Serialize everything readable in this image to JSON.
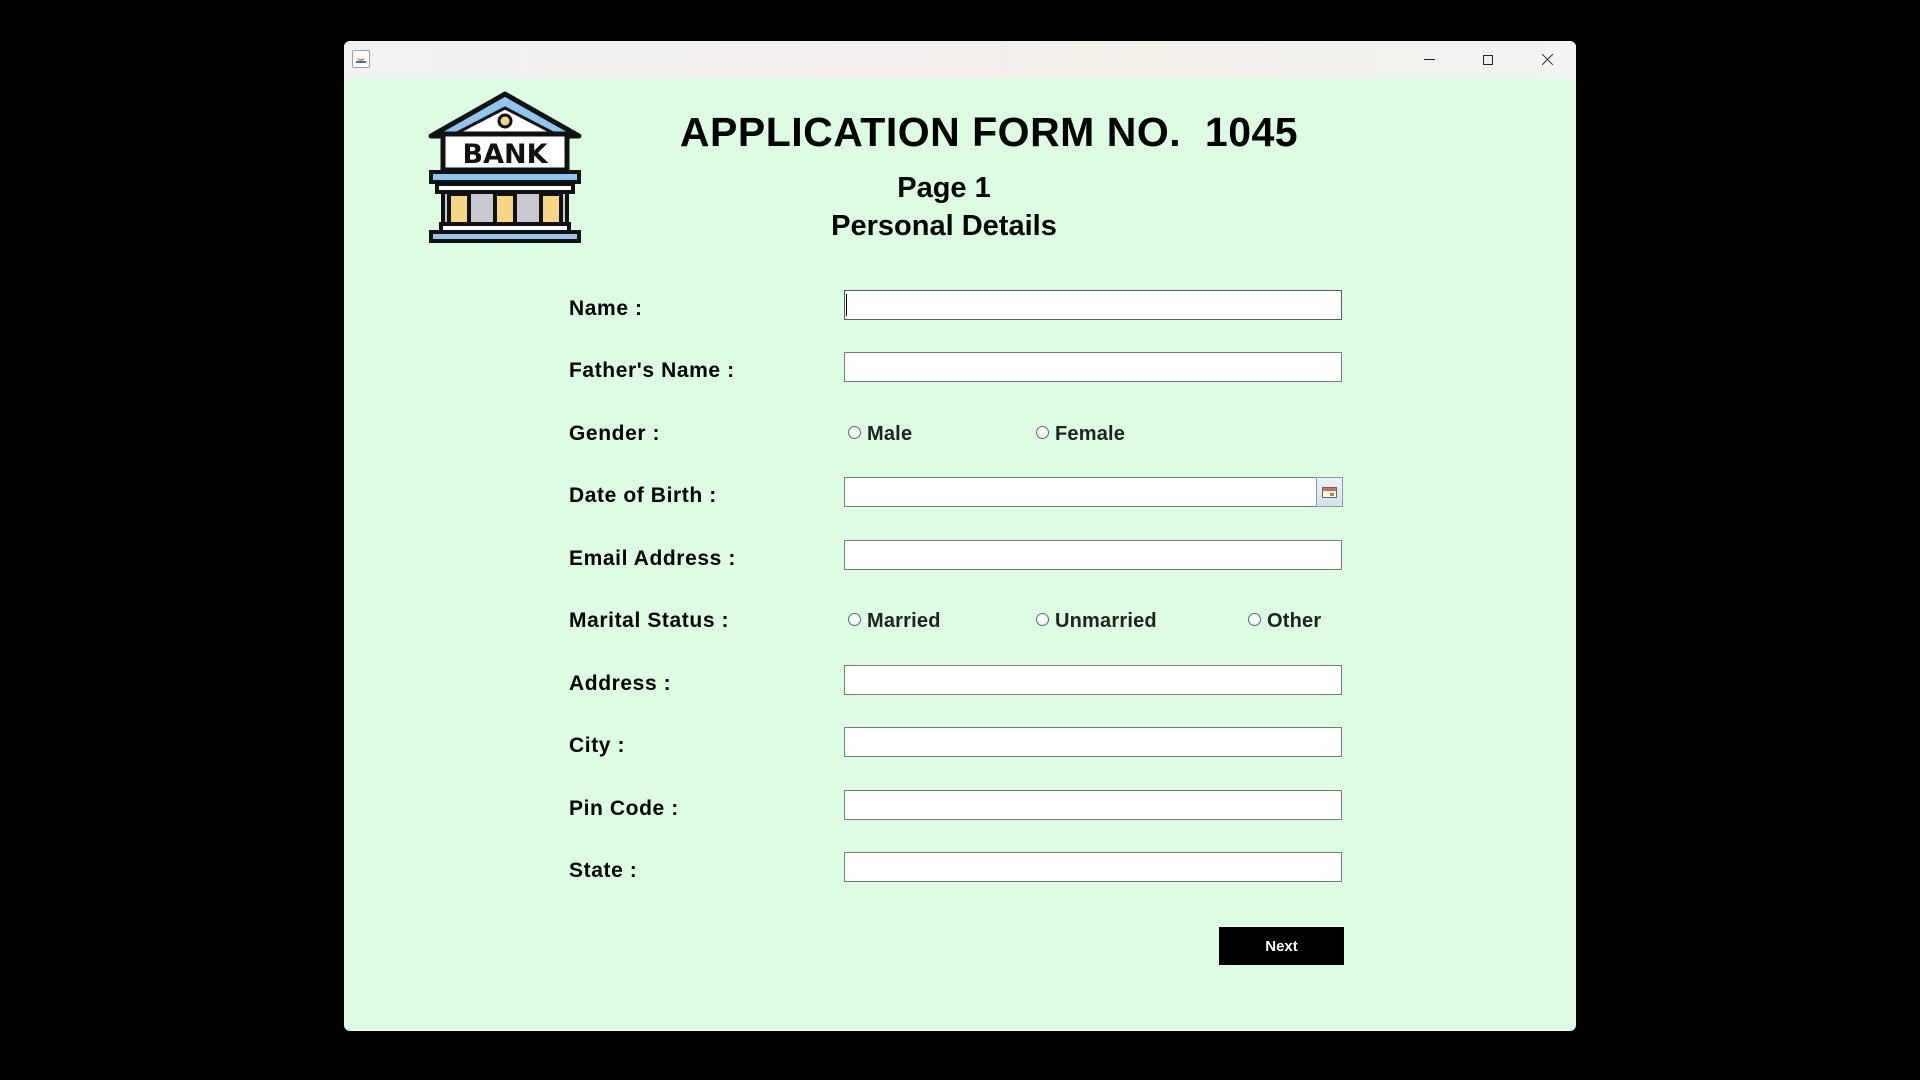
{
  "window": {
    "app_icon": "java-cup-icon",
    "controls": {
      "minimize": "minimize-icon",
      "maximize": "maximize-icon",
      "close": "close-icon"
    }
  },
  "header": {
    "logo_text": "BANK",
    "title": "APPLICATION FORM NO.  1045",
    "page": "Page 1",
    "section": "Personal Details"
  },
  "form": {
    "name": {
      "label": "Name :",
      "value": ""
    },
    "father_name": {
      "label": "Father's Name :",
      "value": ""
    },
    "gender": {
      "label": "Gender :",
      "options": [
        "Male",
        "Female"
      ]
    },
    "dob": {
      "label": "Date of Birth :",
      "value": "",
      "button_icon": "calendar-icon"
    },
    "email": {
      "label": "Email Address :",
      "value": ""
    },
    "marital_status": {
      "label": "Marital Status :",
      "options": [
        "Married",
        "Unmarried",
        "Other"
      ]
    },
    "address": {
      "label": "Address :",
      "value": ""
    },
    "city": {
      "label": "City :",
      "value": ""
    },
    "pin_code": {
      "label": "Pin Code :",
      "value": ""
    },
    "state": {
      "label": "State :",
      "value": ""
    },
    "next_label": "Next"
  },
  "colors": {
    "background": "#dcfde2",
    "button": "#000000",
    "logo_accent": "#8dc6f0",
    "logo_columns": "#f6d680"
  }
}
